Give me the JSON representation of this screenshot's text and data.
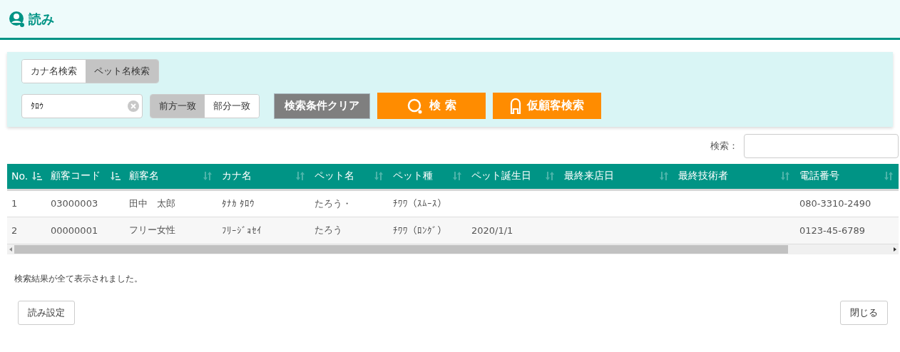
{
  "header": {
    "title": "読み"
  },
  "search_tabs": [
    {
      "label": "カナ名検索",
      "selected": false
    },
    {
      "label": "ペット名検索",
      "selected": true
    }
  ],
  "name_field": {
    "value": "ﾀﾛｳ"
  },
  "match_modes": [
    {
      "label": "前方一致",
      "selected": true
    },
    {
      "label": "部分一致",
      "selected": false
    }
  ],
  "buttons": {
    "clear": "検索条件クリア",
    "search": "検 索",
    "temp_customer": "仮顧客検索"
  },
  "table_search": {
    "label": "検索："
  },
  "table": {
    "columns": [
      {
        "label": "No.",
        "sorted": true
      },
      {
        "label": "顧客コード",
        "sorted": true
      },
      {
        "label": "顧客名",
        "sorted": false
      },
      {
        "label": "カナ名",
        "sorted": false
      },
      {
        "label": "ペット名",
        "sorted": false
      },
      {
        "label": "ペット種",
        "sorted": false
      },
      {
        "label": "ペット誕生日",
        "sorted": false
      },
      {
        "label": "最終来店日",
        "sorted": false
      },
      {
        "label": "最終技術者",
        "sorted": false
      },
      {
        "label": "電話番号",
        "sorted": false
      }
    ],
    "rows": [
      [
        "1",
        "03000003",
        "田中　太郎",
        "ﾀﾅｶ ﾀﾛｳ",
        "たろう・",
        "ﾁﾜﾜ（ｽﾑｰｽ）",
        "",
        "",
        "",
        "080-3310-2490"
      ],
      [
        "2",
        "00000001",
        "フリー女性",
        "ﾌﾘｰｼﾞｮｾｲ",
        "たろう",
        "ﾁﾜﾜ（ﾛﾝｸﾞ）",
        "2020/1/1",
        "",
        "",
        "0123-45-6789"
      ]
    ]
  },
  "status": "検索結果が全て表示されました。",
  "footer": {
    "settings": "読み設定",
    "close": "閉じる"
  }
}
